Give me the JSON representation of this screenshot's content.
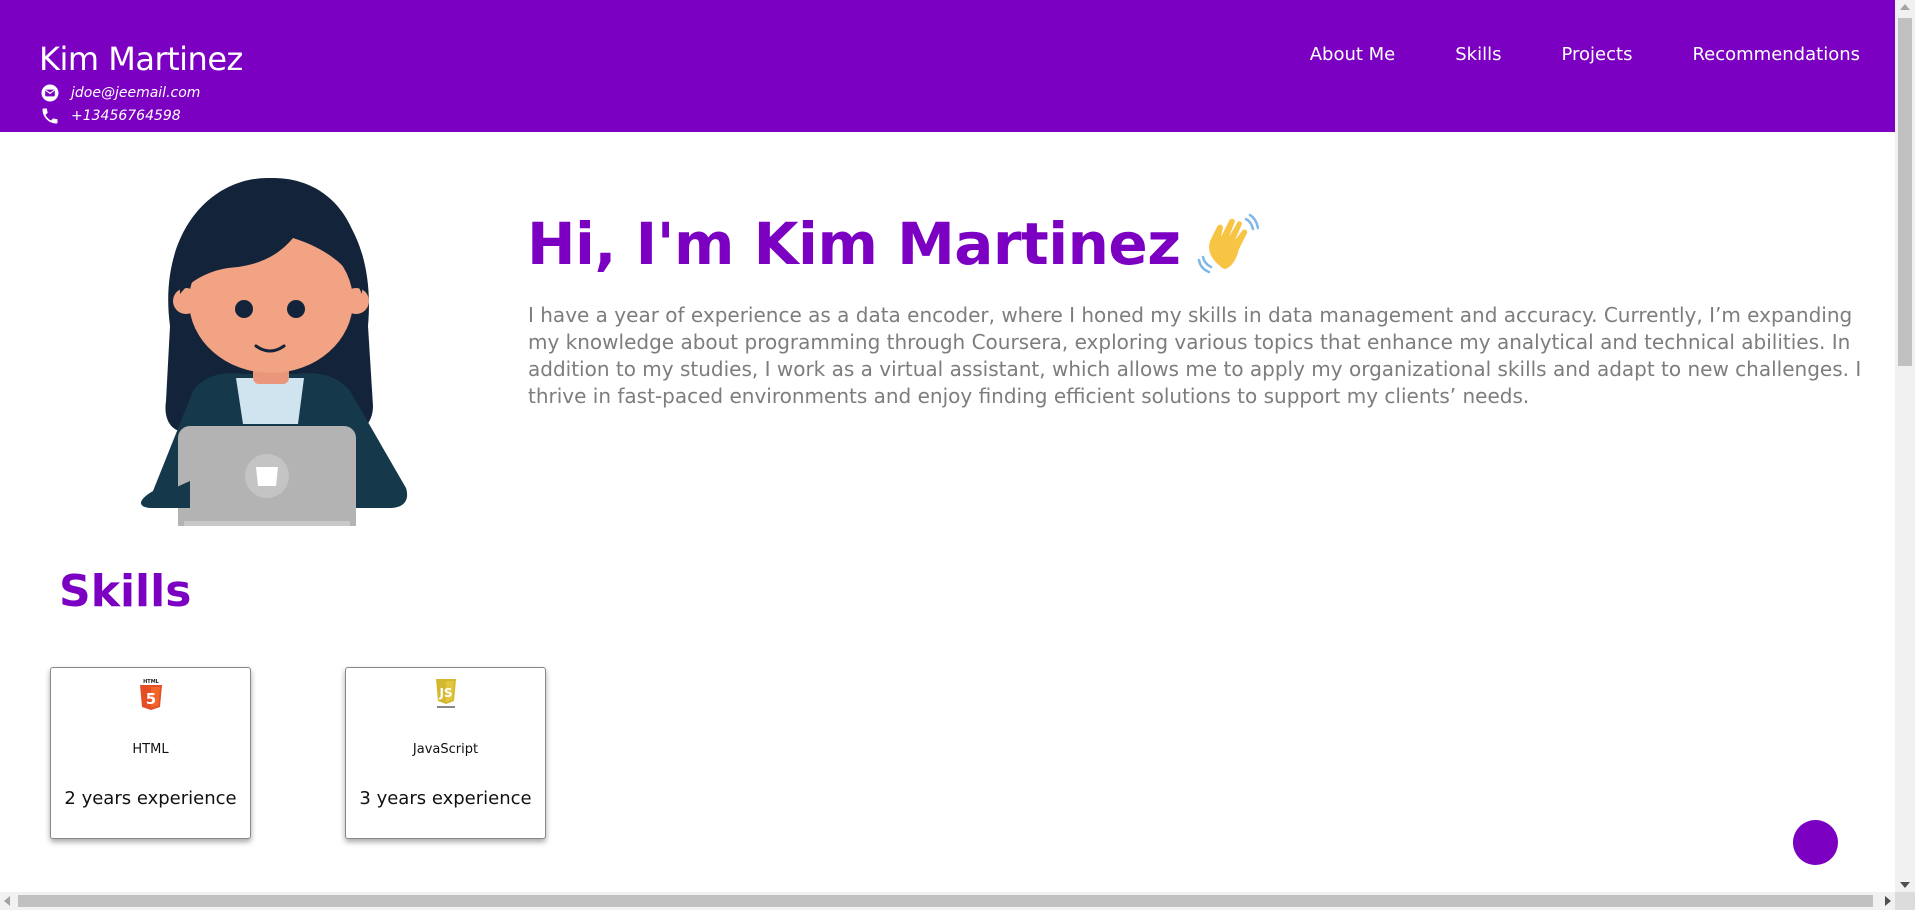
{
  "header": {
    "name": "Kim Martinez",
    "email": "jdoe@jeemail.com",
    "phone": "+13456764598",
    "nav": [
      "About Me",
      "Skills",
      "Projects",
      "Recommendations"
    ]
  },
  "hero": {
    "title": "Hi, I'm Kim Martinez",
    "bio": "I have a year of experience as a data encoder, where I honed my skills in data management and accuracy. Currently, I’m expanding my knowledge about programming through Coursera, exploring various topics that enhance my analytical and technical abilities. In addition to my studies, I work as a virtual assistant, which allows me to apply my organizational skills and adapt to new challenges. I thrive in fast-paced environments and enjoy finding efficient solutions to support my clients’ needs."
  },
  "skills": {
    "heading": "Skills",
    "items": [
      {
        "name": "HTML",
        "experience": "2 years experience",
        "icon": "html5-logo-icon"
      },
      {
        "name": "JavaScript",
        "experience": "3 years experience",
        "icon": "javascript-logo-icon"
      }
    ]
  },
  "icons": {
    "email": "envelope-icon",
    "phone": "phone-icon",
    "wave": "waving-hand-icon"
  },
  "colors": {
    "accent": "#7b00c2",
    "bio_text": "#7d7d7d"
  }
}
